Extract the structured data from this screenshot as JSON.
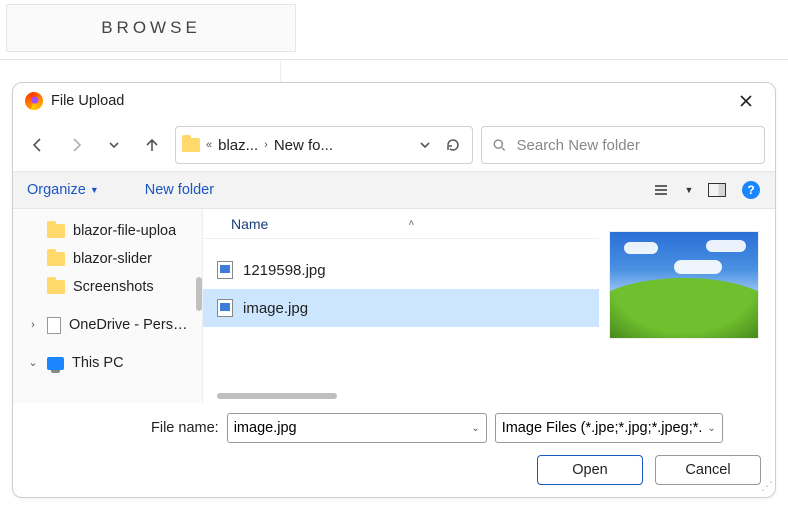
{
  "page": {
    "browse_label": "BROWSE"
  },
  "dialog": {
    "title": "File Upload",
    "path": {
      "seg1": "blaz...",
      "seg2": "New fo..."
    },
    "search_placeholder": "Search New folder",
    "toolbar": {
      "organize": "Organize",
      "new_folder": "New folder"
    },
    "tree": {
      "items": [
        {
          "label": "blazor-file-uploa"
        },
        {
          "label": "blazor-slider"
        },
        {
          "label": "Screenshots"
        }
      ],
      "onedrive": "OneDrive - Person",
      "thispc": "This PC"
    },
    "list": {
      "column": "Name",
      "files": [
        {
          "name": "1219598.jpg"
        },
        {
          "name": "image.jpg"
        }
      ]
    },
    "footer": {
      "filename_label": "File name:",
      "filename_value": "image.jpg",
      "filetype_text": "Image Files (*.jpe;*.jpg;*.jpeg;*.g",
      "open": "Open",
      "cancel": "Cancel"
    }
  }
}
